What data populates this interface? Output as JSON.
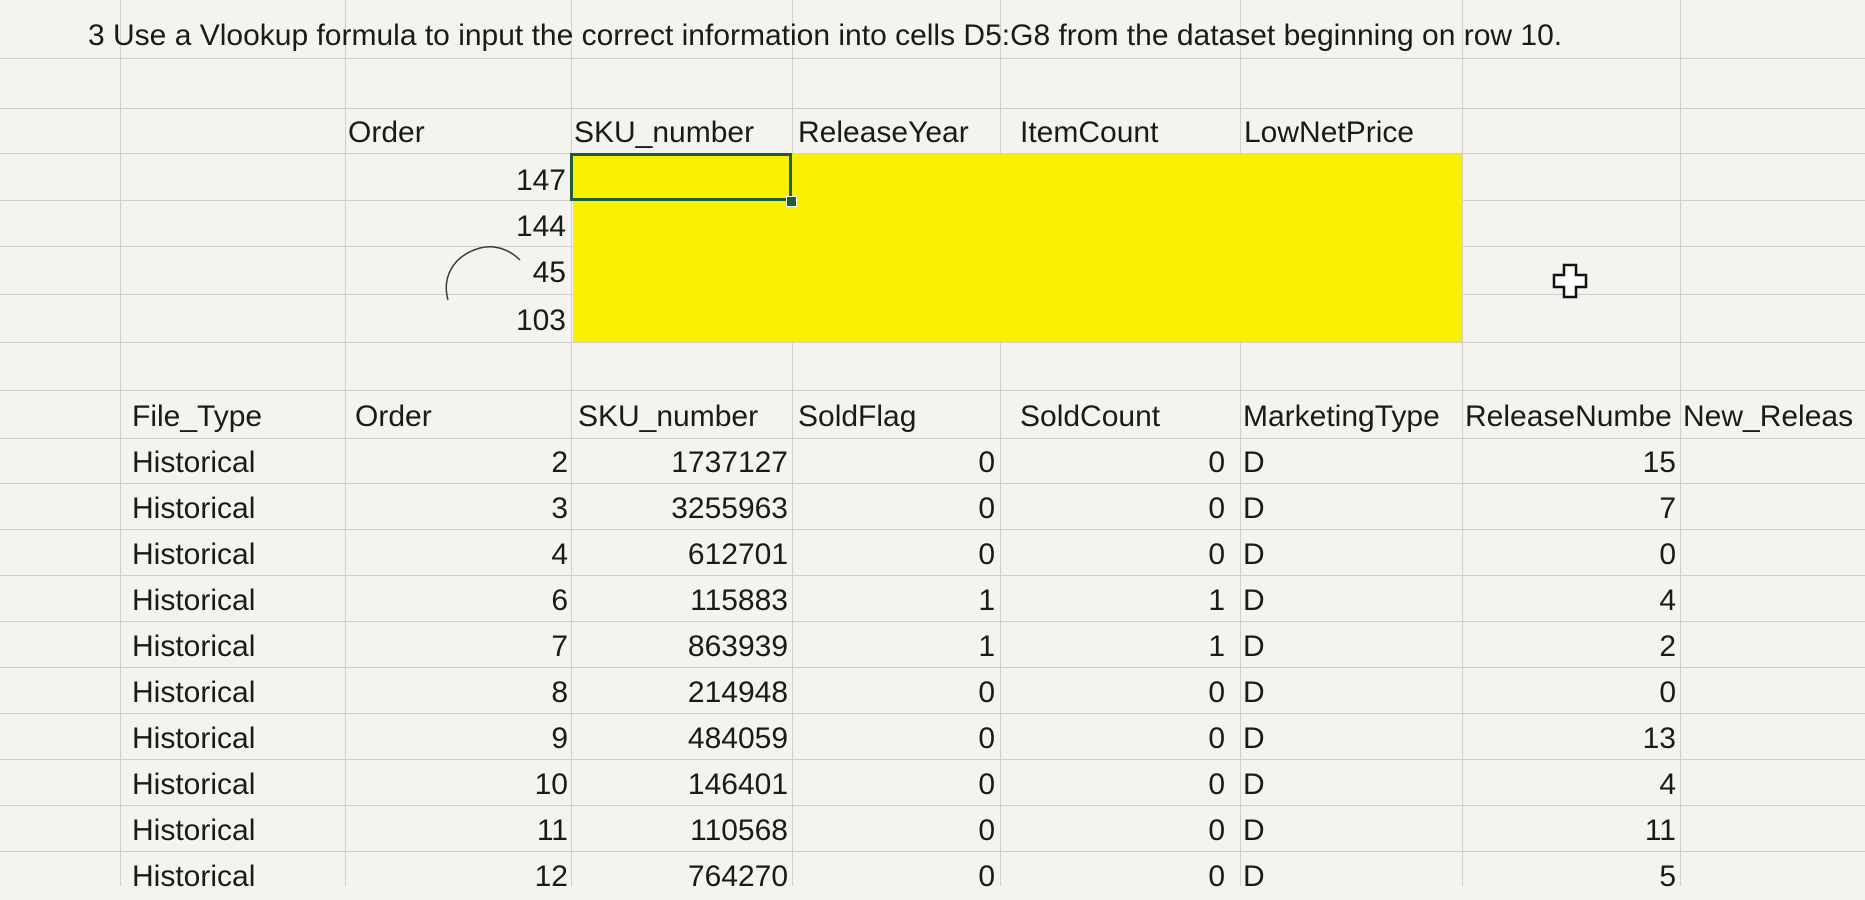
{
  "instruction": "3 Use a Vlookup formula to input the correct information into cells D5:G8 from the dataset beginning on row 10.",
  "lookup_table": {
    "headers": [
      "Order",
      "SKU_number",
      "ReleaseYear",
      "ItemCount",
      "LowNetPrice"
    ],
    "orders": [
      "147",
      "144",
      "45",
      "103"
    ]
  },
  "dataset": {
    "headers": [
      "File_Type",
      "Order",
      "SKU_number",
      "SoldFlag",
      "SoldCount",
      "MarketingType",
      "ReleaseNumbe",
      "New_Releas"
    ],
    "rows": [
      [
        "Historical",
        "2",
        "1737127",
        "0",
        "0",
        "D",
        "15"
      ],
      [
        "Historical",
        "3",
        "3255963",
        "0",
        "0",
        "D",
        "7"
      ],
      [
        "Historical",
        "4",
        "612701",
        "0",
        "0",
        "D",
        "0"
      ],
      [
        "Historical",
        "6",
        "115883",
        "1",
        "1",
        "D",
        "4"
      ],
      [
        "Historical",
        "7",
        "863939",
        "1",
        "1",
        "D",
        "2"
      ],
      [
        "Historical",
        "8",
        "214948",
        "0",
        "0",
        "D",
        "0"
      ],
      [
        "Historical",
        "9",
        "484059",
        "0",
        "0",
        "D",
        "13"
      ],
      [
        "Historical",
        "10",
        "146401",
        "0",
        "0",
        "D",
        "4"
      ],
      [
        "Historical",
        "11",
        "110568",
        "0",
        "0",
        "D",
        "11"
      ],
      [
        "Historical",
        "12",
        "764270",
        "0",
        "0",
        "D",
        "5"
      ]
    ]
  },
  "colors": {
    "highlight": "#f7f000",
    "selection": "#1d5e33",
    "grid": "#cfd0cc"
  },
  "icons": {
    "cursor": "plus-cursor-icon"
  }
}
